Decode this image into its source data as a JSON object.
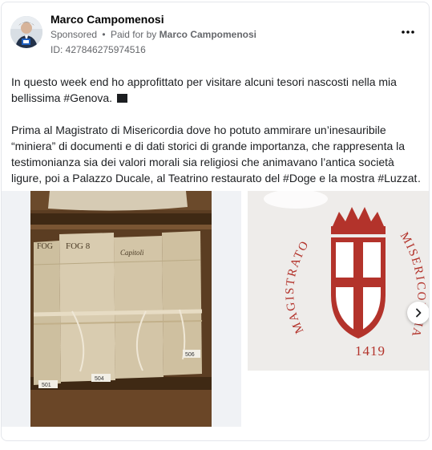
{
  "post": {
    "author": "Marco Campomenosi",
    "sponsored_label": "Sponsored",
    "separator": "•",
    "paid_for_prefix": "Paid for by",
    "paid_for_name": "Marco Campomenosi",
    "ad_id": "ID: 427846275974516",
    "more_icon": "more-horizontal-icon",
    "text_lines_p1": [
      "In questo week end ho approfittato per visitare alcuni tesori nascosti nella mia",
      "bellissima #Genova."
    ],
    "text_lines_p2": [
      "Prima al Magistrato di Misericordia dove ho potuto ammirare un’inesauribile",
      "“miniera” di documenti e di dati storici di grande importanza, che rappresenta la",
      "testimonianza sia dei valori morali sia religiosi che animavano l’antica società",
      "ligure, poi a Palazzo Ducale, al Teatrino restaurato del #Doge e la mostra #Luzzat…"
    ]
  },
  "carousel": {
    "slide2": {
      "arc_text_left": "MAGISTRATO DI",
      "arc_text_right": "MISERICORDIA",
      "year": "1419"
    },
    "next_icon": "chevron-right-icon"
  },
  "archive_labels": {
    "box1": "FOG",
    "box2": "FOG 8",
    "box3": "Capitoli",
    "num1": "501",
    "num2": "504",
    "num3": "506"
  },
  "colors": {
    "author": "#050505",
    "meta": "#65676b",
    "emblem_red": "#b3332b",
    "paper": "#d9ccb0"
  }
}
